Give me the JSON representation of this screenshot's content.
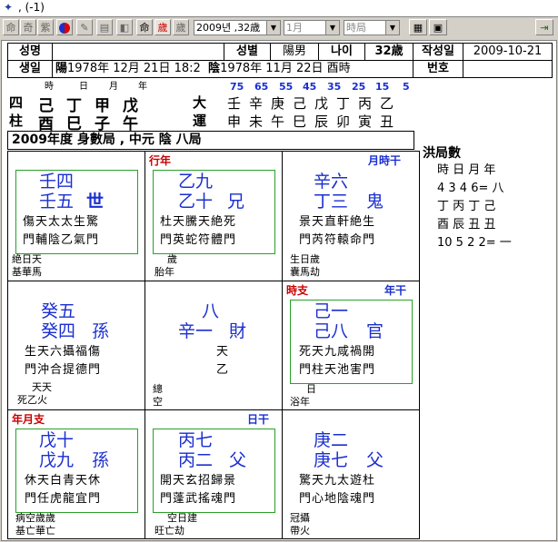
{
  "title": {
    "text": ", (-1)"
  },
  "toolbar": {
    "buttons": [
      "命",
      "奇",
      "紫",
      "",
      "",
      "",
      "",
      "命",
      "歲",
      "歲"
    ],
    "year_select": "2009년 ,32歳",
    "month_select": "1月",
    "hour_select": "時局"
  },
  "info": {
    "name_label": "성명",
    "sex_label": "성별",
    "sex_value": "陽男",
    "age_label": "나이",
    "age_value": "32歳",
    "date_label": "작성일",
    "date_value": "2009-10-21",
    "birth_label": "생일",
    "solar_prefix": "陽",
    "solar_value": "1978年  12月  21日  18:2",
    "lunar_prefix": "陰",
    "lunar_value": "1978年  11月  22日  酉時",
    "num_label": "번호"
  },
  "pillars": {
    "labels": [
      "時",
      "日",
      "月",
      "年"
    ],
    "side_top": "四",
    "side_bottom": "柱",
    "stems": "己丁甲戊",
    "branches": "酉巳子午",
    "daeun_top": "大",
    "daeun_bottom": "運",
    "ages": [
      "75",
      "65",
      "55",
      "45",
      "35",
      "25",
      "15",
      "5"
    ],
    "daeun_stems": "壬辛庚己戊丁丙乙",
    "daeun_branches": "申未午巳辰卯寅丑"
  },
  "banner": "2009年度 身數局 ,  中元 陰 八局",
  "hongguk": {
    "title": "洪局數",
    "row1": "時 日 月 年",
    "row2": "4  3  4  6= 八",
    "row3": "丁 丙 丁 己",
    "row4": "酉 辰 丑 丑",
    "row5": "10  5  2  2=  一"
  },
  "palaces": {
    "p1": {
      "line1": "壬四",
      "line2": "壬五",
      "mark": "世",
      "r1": "傷天太太生驚",
      "r2": "門輔陰乙氣門",
      "b1": "絶日天",
      "b2": "基華馬"
    },
    "p2": {
      "tag": "行年",
      "line1": "乙九",
      "line2": "乙十",
      "mark": "兄",
      "r1": "杜天騰天絶死",
      "r2": "門英蛇符體門",
      "b1": "歲",
      "b2": "胎年"
    },
    "p3": {
      "tag": "月時干",
      "line1": "辛六",
      "line2": "丁三",
      "mark": "鬼",
      "r1": "景天直軒絶生",
      "r2": "門芮符轅命門",
      "b1": "生日歲",
      "b2": "囊馬劫"
    },
    "p4": {
      "line1": "癸五",
      "line2": "癸四",
      "mark": "孫",
      "r1": "生天六攝福傷",
      "r2": "門沖合提德門",
      "b0": "天天",
      "b1": "死乙火"
    },
    "p5": {
      "line1": "八",
      "line2": "辛一",
      "mark": "財",
      "mid1": "天",
      "mid2": "乙",
      "b1": "總",
      "b2": "空"
    },
    "p6": {
      "tag1": "時支",
      "tag2": "年干",
      "line1": "己一",
      "line2": "己八",
      "mark": "官",
      "r1": "死天九咸禍開",
      "r2": "門柱天池害門",
      "b1": "日",
      "b2": "浴年"
    },
    "p7": {
      "tag": "年月支",
      "line1": "戊十",
      "line2": "戊九",
      "mark": "孫",
      "r1": "休天白青天休",
      "r2": "門任虎龍宜門",
      "b1": "病空歲歲",
      "b2": "基亡華亡"
    },
    "p8": {
      "tag": "日干",
      "line1": "丙七",
      "line2": "丙二",
      "mark": "父",
      "r1": "開天玄招歸景",
      "r2": "門蓬武搖魂門",
      "b1": "空日建",
      "b2": "旺亡劫"
    },
    "p9": {
      "line1": "庚二",
      "line2": "庚七",
      "mark": "父",
      "r1": "驚天九太遊杜",
      "r2": "門心地陰魂門",
      "b1": "冠攝",
      "b2": "帶火"
    }
  }
}
